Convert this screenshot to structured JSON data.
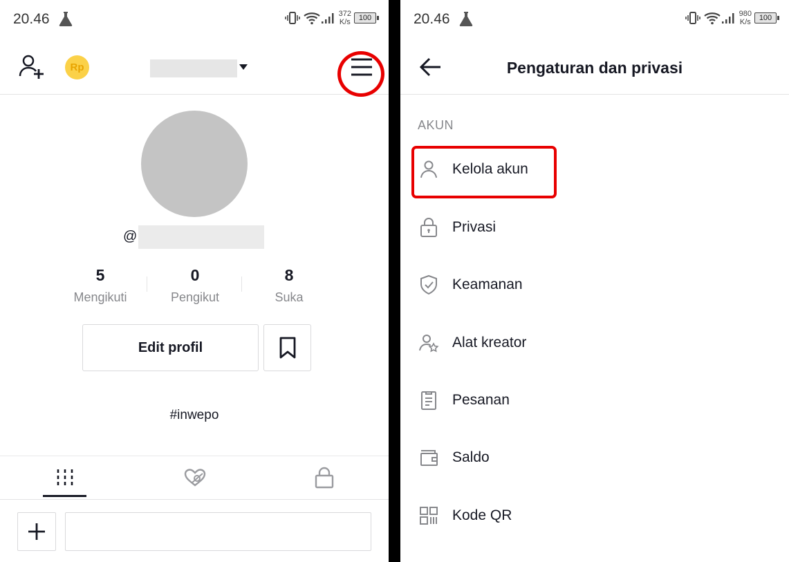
{
  "left_screen": {
    "status_bar": {
      "time": "20.46",
      "speed_value": "372",
      "speed_unit": "K/s",
      "battery": "100"
    },
    "stats": [
      {
        "value": "5",
        "label": "Mengikuti"
      },
      {
        "value": "0",
        "label": "Pengikut"
      },
      {
        "value": "8",
        "label": "Suka"
      }
    ],
    "handle_prefix": "@",
    "edit_profile_label": "Edit profil",
    "bio": "#inwepo"
  },
  "right_screen": {
    "status_bar": {
      "time": "20.46",
      "speed_value": "980",
      "speed_unit": "K/s",
      "battery": "100"
    },
    "title": "Pengaturan dan privasi",
    "section_label": "AKUN",
    "items": [
      {
        "label": "Kelola akun",
        "icon": "person-icon"
      },
      {
        "label": "Privasi",
        "icon": "lock-icon"
      },
      {
        "label": "Keamanan",
        "icon": "shield-check-icon"
      },
      {
        "label": "Alat kreator",
        "icon": "person-star-icon"
      },
      {
        "label": "Pesanan",
        "icon": "clipboard-icon"
      },
      {
        "label": "Saldo",
        "icon": "wallet-icon"
      },
      {
        "label": "Kode QR",
        "icon": "qr-code-icon"
      }
    ]
  },
  "colors": {
    "highlight": "#e80000",
    "coin": "#fbd148",
    "text": "#161823",
    "muted": "#86878b"
  }
}
